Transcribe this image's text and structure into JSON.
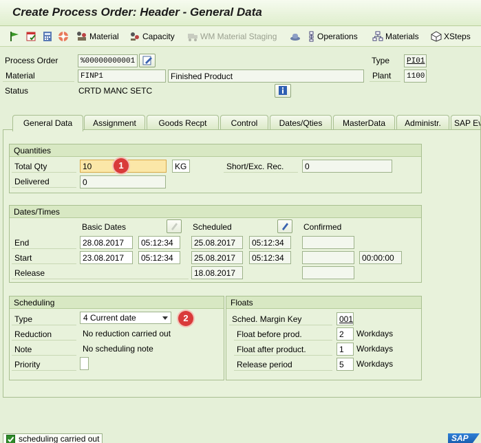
{
  "window": {
    "title": "Create Process Order: Header - General Data"
  },
  "toolbar": {
    "material": "Material",
    "capacity": "Capacity",
    "wm_staging": "WM Material Staging",
    "operations": "Operations",
    "materials": "Materials",
    "xsteps": "XSteps"
  },
  "header": {
    "process_order_label": "Process Order",
    "process_order_value": "%00000000001",
    "type_label": "Type",
    "type_value": "PI01",
    "material_label": "Material",
    "material_value": "FINP1",
    "material_desc": "Finished Product",
    "plant_label": "Plant",
    "plant_value": "1100",
    "status_label": "Status",
    "status_value": "CRTD MANC SETC"
  },
  "tabs": [
    "General Data",
    "Assignment",
    "Goods Recpt",
    "Control",
    "Dates/Qties",
    "MasterData",
    "Administr.",
    "SAP Eve"
  ],
  "quantities": {
    "title": "Quantities",
    "total_qty_label": "Total Qty",
    "total_qty_value": "10",
    "unit": "KG",
    "short_exc_label": "Short/Exc. Rec.",
    "short_exc_value": "0",
    "delivered_label": "Delivered",
    "delivered_value": "0"
  },
  "dates": {
    "title": "Dates/Times",
    "basic_label": "Basic Dates",
    "scheduled_label": "Scheduled",
    "confirmed_label": "Confirmed",
    "end_label": "End",
    "start_label": "Start",
    "release_label": "Release",
    "end_basic_date": "28.08.2017",
    "end_basic_time": "05:12:34",
    "end_sched_date": "25.08.2017",
    "end_sched_time": "05:12:34",
    "start_basic_date": "23.08.2017",
    "start_basic_time": "05:12:34",
    "start_sched_date": "25.08.2017",
    "start_sched_time": "05:12:34",
    "start_confirmed_time": "00:00:00",
    "release_sched_date": "18.08.2017"
  },
  "scheduling": {
    "title": "Scheduling",
    "type_label": "Type",
    "type_value": "4 Current date",
    "reduction_label": "Reduction",
    "reduction_value": "No reduction carried out",
    "note_label": "Note",
    "note_value": "No scheduling note",
    "priority_label": "Priority"
  },
  "floats": {
    "title": "Floats",
    "margin_key_label": "Sched. Margin Key",
    "margin_key_value": "001",
    "float_before_label": "Float before prod.",
    "float_before_value": "2",
    "float_after_label": "Float after product.",
    "float_after_value": "1",
    "release_period_label": "Release period",
    "release_period_value": "5",
    "unit": "Workdays"
  },
  "annotations": {
    "badge1": "1",
    "badge2": "2"
  },
  "status_bar": {
    "message": "scheduling carried out",
    "logo": "SAP"
  },
  "colors": {
    "accent_red": "#d93a3a",
    "background": "#e5f0d8",
    "tab_active": "#e8f2db"
  }
}
